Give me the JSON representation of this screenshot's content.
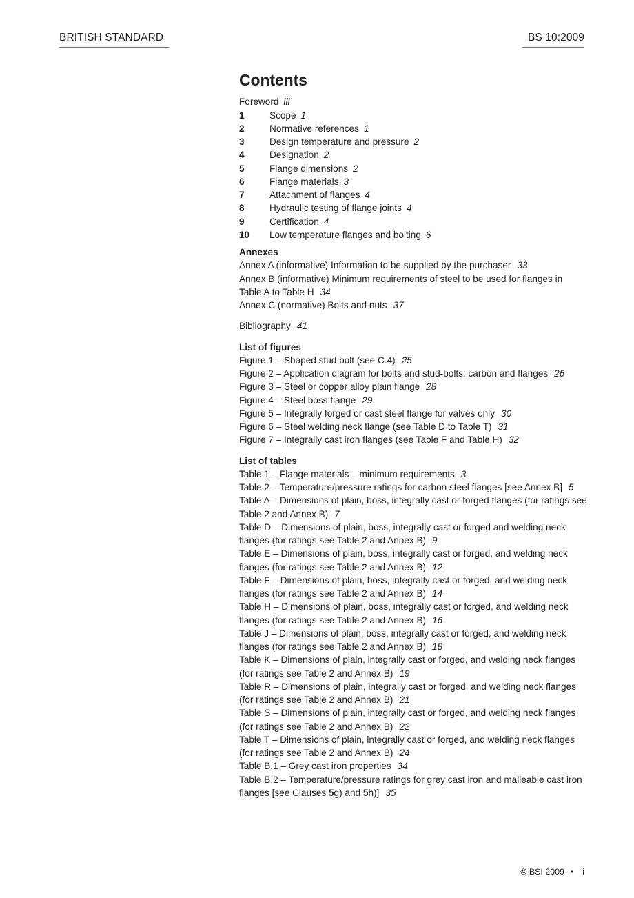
{
  "header": {
    "left": "BRITISH STANDARD",
    "right": "BS 10:2009"
  },
  "contents": {
    "title": "Contents",
    "foreword": {
      "label": "Foreword",
      "page": "iii"
    },
    "clauses": [
      {
        "num": "1",
        "title": "Scope",
        "page": "1"
      },
      {
        "num": "2",
        "title": "Normative references",
        "page": "1"
      },
      {
        "num": "3",
        "title": "Design temperature and pressure",
        "page": "2"
      },
      {
        "num": "4",
        "title": "Designation",
        "page": "2"
      },
      {
        "num": "5",
        "title": "Flange dimensions",
        "page": "2"
      },
      {
        "num": "6",
        "title": "Flange materials",
        "page": "3"
      },
      {
        "num": "7",
        "title": "Attachment of flanges",
        "page": "4"
      },
      {
        "num": "8",
        "title": "Hydraulic testing of flange joints",
        "page": "4"
      },
      {
        "num": "9",
        "title": "Certification",
        "page": "4"
      },
      {
        "num": "10",
        "title": "Low temperature flanges and bolting",
        "page": "6"
      }
    ],
    "annexes": {
      "heading": "Annexes",
      "items": [
        {
          "title": "Annex A (informative)  Information to be supplied by the purchaser",
          "page": "33"
        },
        {
          "title": "Annex B (informative)  Minimum requirements of steel to be used for flanges in Table A to Table H",
          "page": "34"
        },
        {
          "title": "Annex C (normative)  Bolts and nuts",
          "page": "37"
        }
      ]
    },
    "bibliography": {
      "label": "Bibliography",
      "page": "41"
    },
    "figures": {
      "heading": "List of figures",
      "items": [
        {
          "title": "Figure 1 – Shaped stud bolt (see C.4)",
          "page": "25"
        },
        {
          "title": "Figure 2 – Application diagram for bolts and stud-bolts: carbon and flanges",
          "page": "26"
        },
        {
          "title": "Figure 3 – Steel or copper alloy plain flange",
          "page": "28"
        },
        {
          "title": "Figure 4 – Steel boss flange",
          "page": "29"
        },
        {
          "title": "Figure 5 – Integrally forged or cast steel flange for valves only",
          "page": "30"
        },
        {
          "title": "Figure 6 – Steel welding neck flange (see Table D to Table T)",
          "page": "31"
        },
        {
          "title": "Figure 7 – Integrally cast iron flanges (see Table F and Table H)",
          "page": "32"
        }
      ]
    },
    "tables": {
      "heading": "List of tables",
      "items": [
        {
          "title": "Table 1 – Flange materials – minimum requirements",
          "page": "3"
        },
        {
          "title": "Table 2 – Temperature/pressure ratings for carbon steel flanges [see Annex B]",
          "page": "5"
        },
        {
          "title": "Table A – Dimensions of plain, boss, integrally cast or forged flanges (for ratings see Table 2 and Annex B)",
          "page": "7"
        },
        {
          "title": "Table D – Dimensions of plain, boss, integrally cast or forged and welding neck flanges (for ratings see Table 2 and Annex B)",
          "page": "9"
        },
        {
          "title": "Table E – Dimensions of plain, boss, integrally cast or forged, and welding neck flanges (for ratings see Table 2 and Annex B)",
          "page": "12"
        },
        {
          "title": "Table F – Dimensions of plain, boss, integrally cast or forged, and welding neck flanges (for ratings see Table 2 and Annex B)",
          "page": "14"
        },
        {
          "title": "Table H – Dimensions of plain, boss, integrally cast or forged, and welding neck flanges (for ratings see Table 2 and Annex B)",
          "page": "16"
        },
        {
          "title": "Table J – Dimensions of plain, boss, integrally cast or forged, and welding neck flanges (for ratings see Table 2 and Annex B)",
          "page": "18"
        },
        {
          "title": "Table K – Dimensions of plain, integrally cast or forged, and welding neck flanges (for ratings see Table 2 and Annex B)",
          "page": "19"
        },
        {
          "title": "Table R – Dimensions of plain, integrally cast or forged, and welding neck flanges (for ratings see Table 2 and Annex B)",
          "page": "21"
        },
        {
          "title": "Table S – Dimensions of plain, integrally cast or forged, and welding neck flanges (for ratings see Table 2 and Annex B)",
          "page": "22"
        },
        {
          "title": "Table T – Dimensions of plain, integrally cast or forged, and welding neck flanges (for ratings see Table 2 and Annex B)",
          "page": "24"
        },
        {
          "title": "Table B.1 – Grey cast iron properties",
          "page": "34"
        }
      ],
      "last_item": {
        "part1": "Table B.2 – Temperature/pressure ratings for grey cast iron and malleable cast iron flanges [see Clauses ",
        "bold1": "5",
        "part2": "g) and ",
        "bold2": "5",
        "part3": "h)]",
        "page": "35"
      }
    }
  },
  "footer": {
    "copyright": "© BSI 2009",
    "separator": "•",
    "folio": "i"
  }
}
